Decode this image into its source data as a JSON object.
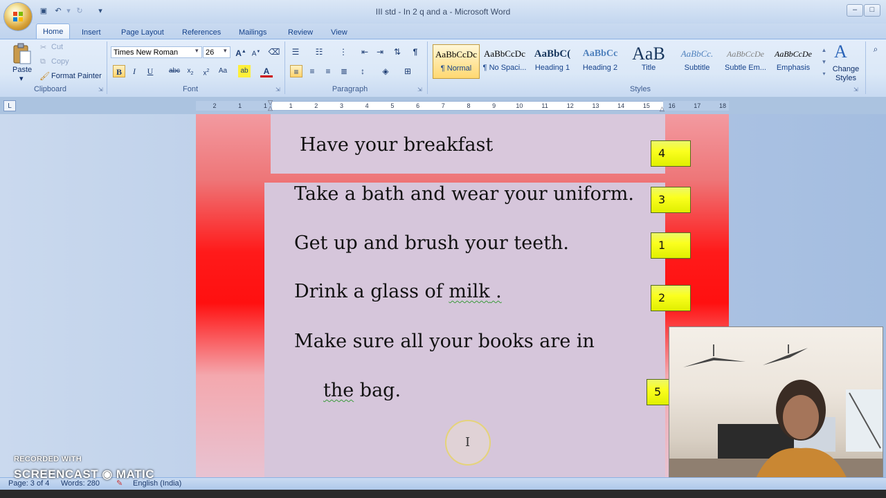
{
  "window": {
    "title": "III std - In 2 q and a - Microsoft Word"
  },
  "tabs": [
    "Home",
    "Insert",
    "Page Layout",
    "References",
    "Mailings",
    "Review",
    "View"
  ],
  "clipboard": {
    "paste": "Paste",
    "cut": "Cut",
    "copy": "Copy",
    "format_painter": "Format Painter",
    "label": "Clipboard"
  },
  "font": {
    "name": "Times New Roman",
    "size": "26",
    "label": "Font"
  },
  "paragraph": {
    "label": "Paragraph"
  },
  "styles": {
    "label": "Styles",
    "items": [
      {
        "preview": "AaBbCcDc",
        "name": "¶ Normal"
      },
      {
        "preview": "AaBbCcDc",
        "name": "¶ No Spaci..."
      },
      {
        "preview": "AaBbC(",
        "name": "Heading 1"
      },
      {
        "preview": "AaBbCc",
        "name": "Heading 2"
      },
      {
        "preview": "AaB",
        "name": "Title"
      },
      {
        "preview": "AaBbCc.",
        "name": "Subtitle"
      },
      {
        "preview": "AaBbCcDe",
        "name": "Subtle Em..."
      },
      {
        "preview": "AaBbCcDe",
        "name": "Emphasis"
      }
    ],
    "change_styles": "Change Styles"
  },
  "ruler": {
    "ticks": [
      "2",
      "1",
      "1",
      "1",
      "2",
      "3",
      "4",
      "5",
      "6",
      "7",
      "8",
      "9",
      "10",
      "11",
      "12",
      "13",
      "14",
      "15",
      "16",
      "17",
      "18"
    ]
  },
  "document": {
    "sentences": [
      {
        "text": "Have your breakfast",
        "number": "4"
      },
      {
        "text": "Take a bath and wear your uniform.",
        "number": "3"
      },
      {
        "text": "Get up and brush your teeth.",
        "number": "1"
      },
      {
        "text_a": "Drink a glass of ",
        "text_b": "milk",
        "text_c": " .",
        "number": "2"
      },
      {
        "text": "Make sure all your books are in"
      },
      {
        "text_a": "the",
        "text_b": " bag.",
        "number": "5"
      }
    ]
  },
  "status": {
    "page": "Page: 3 of 4",
    "words": "Words: 280",
    "language": "English (India)"
  },
  "watermark": {
    "line1": "RECORDED WITH",
    "line2": "SCREENCAST ◉ MATIC"
  },
  "colors": {
    "number_box": "#f5fb10",
    "slide_red": "#ff1a1a",
    "panel": "#d6c6db"
  }
}
